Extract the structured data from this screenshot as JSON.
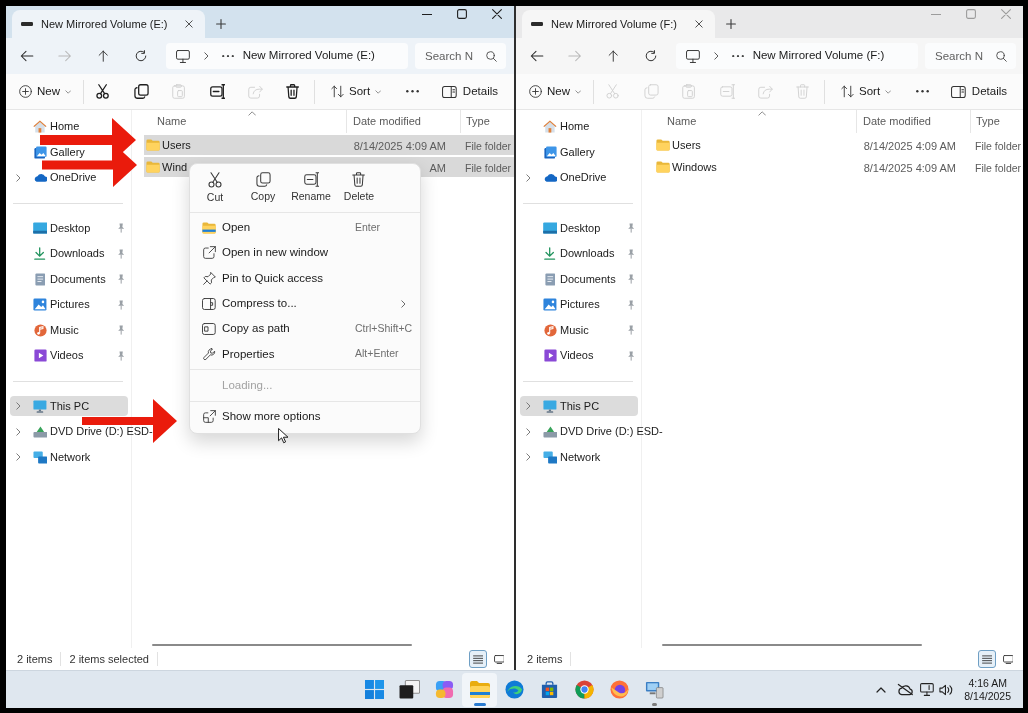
{
  "windows": [
    {
      "active": true,
      "tab": {
        "title": "New Mirrored Volume (E:)"
      },
      "navigation": [
        {
          "kind": "back",
          "disabled": false
        },
        {
          "kind": "forward",
          "disabled": true
        },
        {
          "kind": "up",
          "disabled": false
        },
        {
          "kind": "refresh",
          "disabled": false
        }
      ],
      "address": {
        "path": "New Mirrored Volume (E:)"
      },
      "search": {
        "placeholder": "Search N"
      },
      "toolbar": {
        "new": {
          "label": "New"
        },
        "actions": [
          {
            "kind": "cut",
            "disabled": false
          },
          {
            "kind": "copy",
            "disabled": false
          },
          {
            "kind": "paste",
            "disabled": true
          },
          {
            "kind": "rename",
            "disabled": false
          },
          {
            "kind": "share",
            "disabled": true
          },
          {
            "kind": "delete",
            "disabled": false
          }
        ],
        "sort": {
          "label": "Sort"
        },
        "details": {
          "label": "Details"
        }
      },
      "nav": [
        {
          "items": [
            {
              "kind": "home",
              "label": "Home",
              "expandable": false,
              "pinned": false,
              "selected": false
            },
            {
              "kind": "gallery",
              "label": "Gallery",
              "expandable": false,
              "pinned": false,
              "selected": false
            },
            {
              "kind": "onedrive",
              "label": "OneDrive",
              "expandable": true,
              "pinned": false,
              "selected": false
            }
          ]
        },
        {
          "items": [
            {
              "kind": "desktop",
              "label": "Desktop",
              "expandable": false,
              "pinned": true,
              "selected": false
            },
            {
              "kind": "downloads",
              "label": "Downloads",
              "expandable": false,
              "pinned": true,
              "selected": false
            },
            {
              "kind": "documents",
              "label": "Documents",
              "expandable": false,
              "pinned": true,
              "selected": false
            },
            {
              "kind": "pictures",
              "label": "Pictures",
              "expandable": false,
              "pinned": true,
              "selected": false
            },
            {
              "kind": "music",
              "label": "Music",
              "expandable": false,
              "pinned": true,
              "selected": false
            },
            {
              "kind": "videos",
              "label": "Videos",
              "expandable": false,
              "pinned": true,
              "selected": false
            }
          ]
        },
        {
          "items": [
            {
              "kind": "this-pc",
              "label": "This PC",
              "expandable": true,
              "pinned": false,
              "selected": true
            },
            {
              "kind": "dvd-drive",
              "label": "DVD Drive (D:) ESD-",
              "expandable": true,
              "pinned": false,
              "selected": false
            },
            {
              "kind": "network",
              "label": "Network",
              "expandable": true,
              "pinned": false,
              "selected": false
            }
          ]
        }
      ],
      "table": {
        "columns": [
          "Name",
          "Date modified",
          "Type"
        ],
        "rows": [
          {
            "name": "Users",
            "date_modified": "8/14/2025 4:09 AM",
            "type": "File folder",
            "selected": true
          },
          {
            "name": "Wind",
            "date_modified": "AM",
            "type": "File folder",
            "selected": true
          }
        ]
      },
      "status_bar": {
        "texts": [
          "2 items",
          "2 items selected"
        ],
        "views": [
          {
            "kind": "details",
            "selected": true
          },
          {
            "kind": "tiles",
            "selected": false
          }
        ]
      }
    },
    {
      "active": false,
      "tab": {
        "title": "New Mirrored Volume (F:)"
      },
      "navigation": [
        {
          "kind": "back",
          "disabled": false
        },
        {
          "kind": "forward",
          "disabled": true
        },
        {
          "kind": "up",
          "disabled": false
        },
        {
          "kind": "refresh",
          "disabled": false
        }
      ],
      "address": {
        "path": "New Mirrored Volume (F:)"
      },
      "search": {
        "placeholder": "Search N"
      },
      "toolbar": {
        "new": {
          "label": "New"
        },
        "actions": [
          {
            "kind": "cut",
            "disabled": true
          },
          {
            "kind": "copy",
            "disabled": true
          },
          {
            "kind": "paste",
            "disabled": true
          },
          {
            "kind": "rename",
            "disabled": true
          },
          {
            "kind": "share",
            "disabled": true
          },
          {
            "kind": "delete",
            "disabled": true
          }
        ],
        "sort": {
          "label": "Sort"
        },
        "details": {
          "label": "Details"
        }
      },
      "nav": [
        {
          "items": [
            {
              "kind": "home",
              "label": "Home",
              "expandable": false,
              "pinned": false,
              "selected": false
            },
            {
              "kind": "gallery",
              "label": "Gallery",
              "expandable": false,
              "pinned": false,
              "selected": false
            },
            {
              "kind": "onedrive",
              "label": "OneDrive",
              "expandable": true,
              "pinned": false,
              "selected": false
            }
          ]
        },
        {
          "items": [
            {
              "kind": "desktop",
              "label": "Desktop",
              "expandable": false,
              "pinned": true,
              "selected": false
            },
            {
              "kind": "downloads",
              "label": "Downloads",
              "expandable": false,
              "pinned": true,
              "selected": false
            },
            {
              "kind": "documents",
              "label": "Documents",
              "expandable": false,
              "pinned": true,
              "selected": false
            },
            {
              "kind": "pictures",
              "label": "Pictures",
              "expandable": false,
              "pinned": true,
              "selected": false
            },
            {
              "kind": "music",
              "label": "Music",
              "expandable": false,
              "pinned": true,
              "selected": false
            },
            {
              "kind": "videos",
              "label": "Videos",
              "expandable": false,
              "pinned": true,
              "selected": false
            }
          ]
        },
        {
          "items": [
            {
              "kind": "this-pc",
              "label": "This PC",
              "expandable": true,
              "pinned": false,
              "selected": true
            },
            {
              "kind": "dvd-drive",
              "label": "DVD Drive (D:) ESD-",
              "expandable": true,
              "pinned": false,
              "selected": false
            },
            {
              "kind": "network",
              "label": "Network",
              "expandable": true,
              "pinned": false,
              "selected": false
            }
          ]
        }
      ],
      "table": {
        "columns": [
          "Name",
          "Date modified",
          "Type"
        ],
        "rows": [
          {
            "name": "Users",
            "date_modified": "8/14/2025 4:09 AM",
            "type": "File folder",
            "selected": false
          },
          {
            "name": "Windows",
            "date_modified": "8/14/2025 4:09 AM",
            "type": "File folder",
            "selected": false
          }
        ]
      },
      "status_bar": {
        "texts": [
          "2 items"
        ],
        "views": [
          {
            "kind": "details",
            "selected": true
          },
          {
            "kind": "tiles",
            "selected": false
          }
        ]
      }
    }
  ],
  "context_menu": {
    "quick_actions": [
      {
        "kind": "cut",
        "label": "Cut"
      },
      {
        "kind": "copy",
        "label": "Copy"
      },
      {
        "kind": "rename",
        "label": "Rename"
      },
      {
        "kind": "delete",
        "label": "Delete"
      }
    ],
    "groups": [
      {
        "items": [
          {
            "kind": "open",
            "label": "Open",
            "shortcut": "Enter",
            "submenu": false,
            "disabled": false
          },
          {
            "kind": "open-new-window",
            "label": "Open in new window",
            "submenu": false,
            "disabled": false
          },
          {
            "kind": "pin",
            "label": "Pin to Quick access",
            "submenu": false,
            "disabled": false
          },
          {
            "kind": "compress",
            "label": "Compress to...",
            "submenu": true,
            "disabled": false
          },
          {
            "kind": "copy-path",
            "label": "Copy as path",
            "shortcut": "Ctrl+Shift+C",
            "submenu": false,
            "disabled": false
          },
          {
            "kind": "properties",
            "label": "Properties",
            "shortcut": "Alt+Enter",
            "submenu": false,
            "disabled": false
          }
        ]
      },
      {
        "items": [
          {
            "kind": "loading",
            "label": "Loading...",
            "submenu": false,
            "disabled": true
          }
        ]
      },
      {
        "items": [
          {
            "kind": "more-options",
            "label": "Show more options",
            "submenu": false,
            "disabled": false
          }
        ]
      }
    ]
  },
  "taskbar": {
    "apps": [
      {
        "kind": "start",
        "active": false,
        "running": false
      },
      {
        "kind": "task-view",
        "active": false,
        "running": false
      },
      {
        "kind": "copilot",
        "active": false,
        "running": false
      },
      {
        "kind": "file-explorer",
        "active": true,
        "running": true
      },
      {
        "kind": "edge",
        "active": false,
        "running": false
      },
      {
        "kind": "store",
        "active": false,
        "running": false
      },
      {
        "kind": "chrome",
        "active": false,
        "running": false
      },
      {
        "kind": "firefox",
        "active": false,
        "running": false
      },
      {
        "kind": "computer",
        "active": false,
        "running": true
      }
    ],
    "clock": {
      "time": "4:16 AM",
      "date": "8/14/2025"
    }
  }
}
